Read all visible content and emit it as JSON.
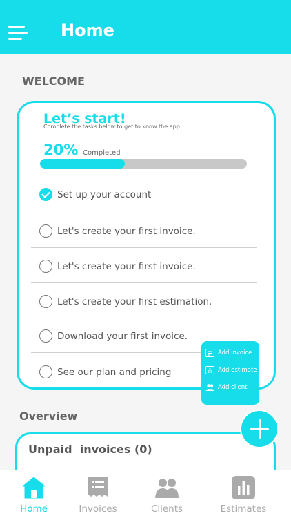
{
  "header": {
    "title": "Home"
  },
  "welcome": {
    "section_label": "WELCOME"
  },
  "card": {
    "title": "Let’s start!",
    "subtitle": "Complete the tasks below to get to know the app",
    "progress_percent_text": "20%",
    "progress_label": "Completed",
    "progress_fraction": 0.41,
    "tasks": [
      {
        "label": "Set up your account",
        "done": true
      },
      {
        "label": "Let's create your first invoice.",
        "done": false
      },
      {
        "label": "Let's create your first invoice.",
        "done": false
      },
      {
        "label": "Let's create your first estimation.",
        "done": false
      },
      {
        "label": "Download your first invoice.",
        "done": false
      },
      {
        "label": "See our plan and pricing",
        "done": false
      }
    ]
  },
  "quick_actions": {
    "items": [
      {
        "label": "Add invoice",
        "icon": "invoice-icon"
      },
      {
        "label": "Add estimate",
        "icon": "estimate-icon"
      },
      {
        "label": "Add client",
        "icon": "client-icon"
      }
    ]
  },
  "overview": {
    "section_label": "Overview",
    "unpaid_label": "Unpaid  invoices",
    "unpaid_count": "(0)"
  },
  "nav": {
    "items": [
      {
        "label": "Home",
        "icon": "home-icon",
        "active": true
      },
      {
        "label": "Invoices",
        "icon": "invoice-icon",
        "active": false
      },
      {
        "label": "Clients",
        "icon": "clients-icon",
        "active": false
      },
      {
        "label": "Estimates",
        "icon": "estimates-icon",
        "active": false
      }
    ]
  },
  "colors": {
    "accent": "#16dde9",
    "text": "#555555",
    "muted": "#aaaaaa",
    "track": "#c8c8c8"
  }
}
